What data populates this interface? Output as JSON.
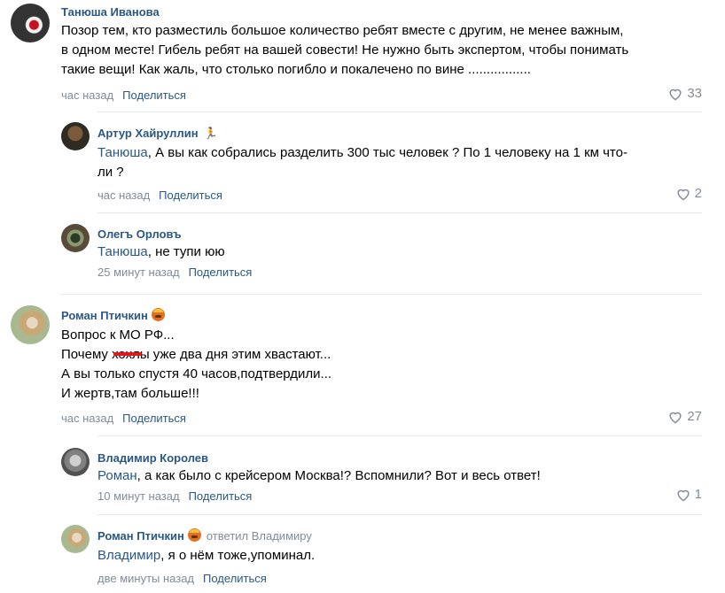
{
  "comments": [
    {
      "author": "Танюша Иванова",
      "lines": [
        "Позор тем, кто разместиль большое количество ребят вместе с другим, не менее важным,",
        "в одном месте! Гибель ребят на вашей совести! Не нужно быть экспертом, чтобы понимать",
        "такие вещи! Как жаль, что столько погибло и покалечено по вине ................."
      ],
      "time": "час назад",
      "share": "Поделиться",
      "likes": "33"
    },
    {
      "author": "Артур Хайруллин",
      "mention": "Танюша",
      "lines": [
        ", А вы как собрались разделить 300 тыс человек ? По 1 человеку на 1 км что-",
        "ли ?"
      ],
      "time": "час назад",
      "share": "Поделиться",
      "likes": "2"
    },
    {
      "author": "Олегъ Орловъ",
      "mention": "Танюша",
      "lines": [
        ", не тупи юю"
      ],
      "time": "25 минут назад",
      "share": "Поделиться"
    },
    {
      "author": "Роман Птичкин",
      "lines": [
        "Вопрос к МО РФ...",
        "Почему хохлы уже два дня этим хвастают...",
        "А вы только спустя 40 часов,подтвердили...",
        "И жертв,там больше!!!"
      ],
      "time": "час назад",
      "share": "Поделиться",
      "likes": "27"
    },
    {
      "author": "Владимир Королев",
      "mention": "Роман",
      "lines": [
        ", а как было с крейсером Москва!? Вспомнили? Вот и весь ответ!"
      ],
      "time": "10 минут назад",
      "share": "Поделиться",
      "likes": "1"
    },
    {
      "author": "Роман Птичкин",
      "replied_to": "ответил Владимиру",
      "mention": "Владимир",
      "lines": [
        ", я о нём тоже,упоминал."
      ],
      "time": "две минуты назад",
      "share": "Поделиться"
    }
  ],
  "colors": {
    "link": "#2a5885",
    "meta": "#818c99",
    "divider": "#e7e8ec"
  },
  "icons": [
    "heart-icon",
    "angry-emoji-icon",
    "runner-icon"
  ]
}
